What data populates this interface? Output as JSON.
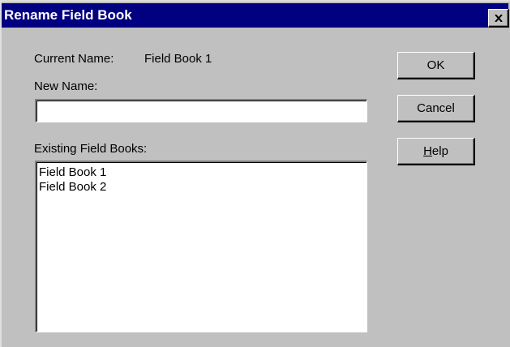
{
  "window": {
    "title": "Rename Field Book",
    "close_icon": "close-icon"
  },
  "form": {
    "current_name_label": "Current Name:",
    "current_name_value": "Field Book 1",
    "new_name_label": "New Name:",
    "new_name_value": "",
    "existing_label": "Existing Field Books:",
    "existing_items": [
      "Field Book 1",
      "Field Book 2"
    ]
  },
  "buttons": {
    "ok": "OK",
    "cancel": "Cancel",
    "help_hotkey": "H",
    "help_rest": "elp"
  },
  "colors": {
    "title_bar": "#000080",
    "dialog_face": "#c0c0c0"
  }
}
